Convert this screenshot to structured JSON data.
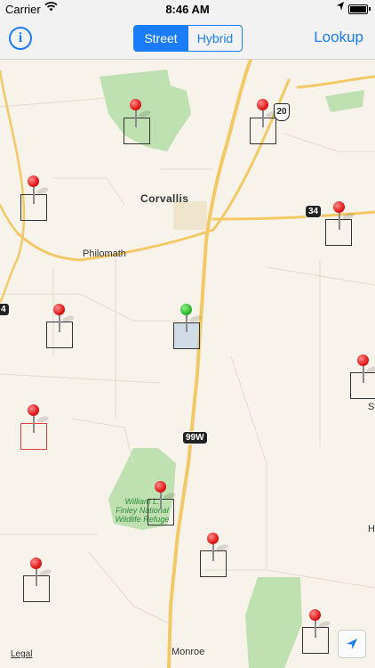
{
  "status_bar": {
    "carrier": "Carrier",
    "time": "8:46 AM"
  },
  "navbar": {
    "info_icon": "i",
    "segments": [
      {
        "label": "Street",
        "selected": true
      },
      {
        "label": "Hybrid",
        "selected": false
      }
    ],
    "lookup_label": "Lookup"
  },
  "map": {
    "places": {
      "corvallis": "Corvallis",
      "philomath": "Philomath",
      "monroe": "Monroe",
      "refuge_line1": "William L.",
      "refuge_line2": "Finley National",
      "refuge_line3": "Wildlife Refuge",
      "edge_s": "S",
      "edge_h": "H"
    },
    "route_shields": {
      "us20": "20",
      "or34": "34",
      "or99w": "99W",
      "edge_4": "4"
    },
    "legal": "Legal",
    "pin_colors": {
      "red": "#e01919",
      "green": "#2db82d"
    },
    "accent": "#1a7cf6"
  }
}
